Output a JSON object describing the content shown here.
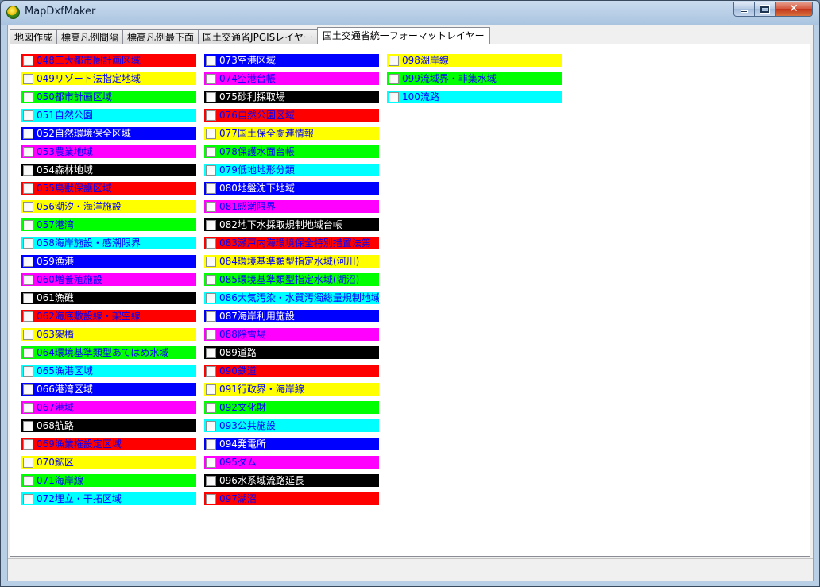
{
  "window": {
    "title": "MapDxfMaker"
  },
  "tabs": [
    "地図作成",
    "標高凡例間隔",
    "標高凡例最下面",
    "国土交通省JPGISレイヤー",
    "国土交通省統一フォーマットレイヤー"
  ],
  "active_tab": 4,
  "colors": {
    "red": "#ff0000",
    "yellow": "#ffff00",
    "green": "#00ff00",
    "cyan": "#00ffff",
    "blue": "#0000ff",
    "magenta": "#ff00ff",
    "black": "#000000"
  },
  "layers": [
    {
      "label": "048三大都市圏計画区域",
      "bg": "red",
      "fg": "#0000ff"
    },
    {
      "label": "049リゾート法指定地域",
      "bg": "yellow",
      "fg": "#0000ff"
    },
    {
      "label": "050都市計画区域",
      "bg": "green",
      "fg": "#0000ff"
    },
    {
      "label": "051自然公園",
      "bg": "cyan",
      "fg": "#0000ff"
    },
    {
      "label": "052自然環境保全区域",
      "bg": "blue",
      "fg": "#ffffff"
    },
    {
      "label": "053農業地域",
      "bg": "magenta",
      "fg": "#0000ff"
    },
    {
      "label": "054森林地域",
      "bg": "black",
      "fg": "#ffffff"
    },
    {
      "label": "055鳥獣保護区域",
      "bg": "red",
      "fg": "#0000ff"
    },
    {
      "label": "056潮汐・海洋施設",
      "bg": "yellow",
      "fg": "#0000ff"
    },
    {
      "label": "057港湾",
      "bg": "green",
      "fg": "#0000ff"
    },
    {
      "label": "058海岸施設・感潮限界",
      "bg": "cyan",
      "fg": "#0000ff"
    },
    {
      "label": "059漁港",
      "bg": "blue",
      "fg": "#ffffff"
    },
    {
      "label": "060増養殖施設",
      "bg": "magenta",
      "fg": "#0000ff"
    },
    {
      "label": "061漁礁",
      "bg": "black",
      "fg": "#ffffff"
    },
    {
      "label": "062海底敷設線・架空線",
      "bg": "red",
      "fg": "#0000ff"
    },
    {
      "label": "063架橋",
      "bg": "yellow",
      "fg": "#0000ff"
    },
    {
      "label": "064環境基準類型あてはめ水域",
      "bg": "green",
      "fg": "#0000ff"
    },
    {
      "label": "065漁港区域",
      "bg": "cyan",
      "fg": "#0000ff"
    },
    {
      "label": "066港湾区域",
      "bg": "blue",
      "fg": "#ffffff"
    },
    {
      "label": "067港域",
      "bg": "magenta",
      "fg": "#0000ff"
    },
    {
      "label": "068航路",
      "bg": "black",
      "fg": "#ffffff"
    },
    {
      "label": "069漁業権設定区域",
      "bg": "red",
      "fg": "#0000ff"
    },
    {
      "label": "070鉱区",
      "bg": "yellow",
      "fg": "#0000ff"
    },
    {
      "label": "071海岸線",
      "bg": "green",
      "fg": "#0000ff"
    },
    {
      "label": "072埋立・干拓区域",
      "bg": "cyan",
      "fg": "#0000ff"
    },
    {
      "label": "073空港区域",
      "bg": "blue",
      "fg": "#ffffff"
    },
    {
      "label": "074空港台帳",
      "bg": "magenta",
      "fg": "#0000ff"
    },
    {
      "label": "075砂利採取場",
      "bg": "black",
      "fg": "#ffffff"
    },
    {
      "label": "076自然公園区域",
      "bg": "red",
      "fg": "#0000ff"
    },
    {
      "label": "077国土保全関連情報",
      "bg": "yellow",
      "fg": "#0000ff"
    },
    {
      "label": "078保護水面台帳",
      "bg": "green",
      "fg": "#0000ff"
    },
    {
      "label": "079低地地形分類",
      "bg": "cyan",
      "fg": "#0000ff"
    },
    {
      "label": "080地盤沈下地域",
      "bg": "blue",
      "fg": "#ffffff"
    },
    {
      "label": "081感潮限界",
      "bg": "magenta",
      "fg": "#0000ff"
    },
    {
      "label": "082地下水採取規制地域台帳",
      "bg": "black",
      "fg": "#ffffff"
    },
    {
      "label": "083瀬戸内海環境保全特別措置法第",
      "bg": "red",
      "fg": "#0000ff"
    },
    {
      "label": "084環境基準類型指定水域(河川)",
      "bg": "yellow",
      "fg": "#0000ff"
    },
    {
      "label": "085環境基準類型指定水域(湖沼)",
      "bg": "green",
      "fg": "#0000ff"
    },
    {
      "label": "086大気汚染・水質汚濁総量規制地域",
      "bg": "cyan",
      "fg": "#0000ff"
    },
    {
      "label": "087海岸利用施設",
      "bg": "blue",
      "fg": "#ffffff"
    },
    {
      "label": "088除雪場",
      "bg": "magenta",
      "fg": "#0000ff"
    },
    {
      "label": "089道路",
      "bg": "black",
      "fg": "#ffffff"
    },
    {
      "label": "090鉄道",
      "bg": "red",
      "fg": "#0000ff"
    },
    {
      "label": "091行政界・海岸線",
      "bg": "yellow",
      "fg": "#0000ff"
    },
    {
      "label": "092文化財",
      "bg": "green",
      "fg": "#0000ff"
    },
    {
      "label": "093公共施設",
      "bg": "cyan",
      "fg": "#0000ff"
    },
    {
      "label": "094発電所",
      "bg": "blue",
      "fg": "#ffffff"
    },
    {
      "label": "095ダム",
      "bg": "magenta",
      "fg": "#0000ff"
    },
    {
      "label": "096水系域流路延長",
      "bg": "black",
      "fg": "#ffffff"
    },
    {
      "label": "097湖沼",
      "bg": "red",
      "fg": "#0000ff"
    },
    {
      "label": "098湖岸線",
      "bg": "yellow",
      "fg": "#0000ff"
    },
    {
      "label": "099流域界・非集水域",
      "bg": "green",
      "fg": "#0000ff"
    },
    {
      "label": "100流路",
      "bg": "cyan",
      "fg": "#0000ff"
    }
  ]
}
